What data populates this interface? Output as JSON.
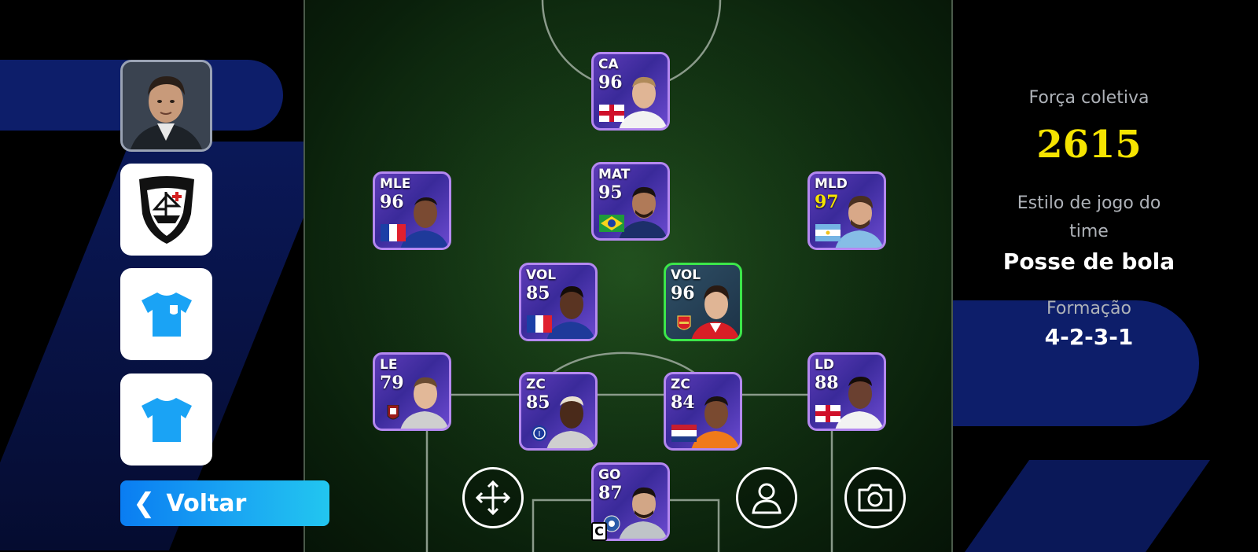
{
  "left_panel": {
    "back_label": "Voltar",
    "back_icon": "chevron-left-icon"
  },
  "squad": {
    "captain_badge": "C",
    "players": [
      {
        "position": "CA",
        "rating": "96",
        "flag": "england",
        "rarity": "epic"
      },
      {
        "position": "MLE",
        "rating": "96",
        "flag": "france",
        "rarity": "epic"
      },
      {
        "position": "MAT",
        "rating": "95",
        "flag": "brazil",
        "rarity": "epic"
      },
      {
        "position": "MLD",
        "rating": "97",
        "flag": "argentina",
        "rarity": "epic"
      },
      {
        "position": "VOL",
        "rating": "85",
        "flag": "france",
        "rarity": "epic"
      },
      {
        "position": "VOL",
        "rating": "96",
        "flag": "arsenal-crest",
        "rarity": "highlight"
      },
      {
        "position": "LE",
        "rating": "79",
        "flag": "club-crest",
        "rarity": "epic"
      },
      {
        "position": "ZC",
        "rating": "85",
        "flag": "inter-crest",
        "rarity": "epic"
      },
      {
        "position": "ZC",
        "rating": "84",
        "flag": "netherlands",
        "rarity": "epic"
      },
      {
        "position": "LD",
        "rating": "88",
        "flag": "england",
        "rarity": "epic"
      },
      {
        "position": "GO",
        "rating": "87",
        "flag": "club-crest",
        "rarity": "epic"
      }
    ]
  },
  "actions": [
    {
      "icon": "move-arrows-icon"
    },
    {
      "icon": "person-icon"
    },
    {
      "icon": "camera-icon"
    }
  ],
  "team_info": {
    "strength_label": "Força coletiva",
    "strength_value": "2615",
    "style_label_line1": "Estilo de jogo do",
    "style_label_line2": "time",
    "style_value": "Posse de bola",
    "formation_label": "Formação",
    "formation_value": "4-2-3-1"
  },
  "colors": {
    "strength": "#f5e400",
    "back_button": "#1aa6f2",
    "kit_icon": "#1aa3f5",
    "card_border": "#b488f0",
    "highlight_border": "#3ce64a"
  }
}
